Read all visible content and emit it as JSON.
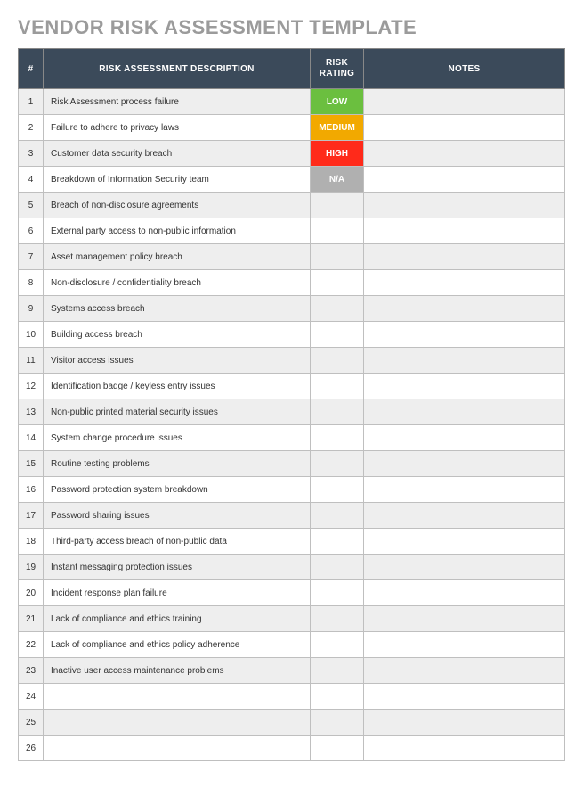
{
  "title": "VENDOR RISK ASSESSMENT TEMPLATE",
  "columns": {
    "num": "#",
    "desc": "RISK ASSESSMENT DESCRIPTION",
    "rating": "RISK RATING",
    "notes": "NOTES"
  },
  "ratingColors": {
    "LOW": "low",
    "MEDIUM": "medium",
    "HIGH": "high",
    "N/A": "na"
  },
  "rows": [
    {
      "num": "1",
      "desc": "Risk Assessment process failure",
      "rating": "LOW",
      "notes": ""
    },
    {
      "num": "2",
      "desc": "Failure to adhere to privacy laws",
      "rating": "MEDIUM",
      "notes": ""
    },
    {
      "num": "3",
      "desc": "Customer data security breach",
      "rating": "HIGH",
      "notes": ""
    },
    {
      "num": "4",
      "desc": "Breakdown of Information Security team",
      "rating": "N/A",
      "notes": ""
    },
    {
      "num": "5",
      "desc": "Breach of non-disclosure agreements",
      "rating": "",
      "notes": ""
    },
    {
      "num": "6",
      "desc": "External party access to non-public information",
      "rating": "",
      "notes": ""
    },
    {
      "num": "7",
      "desc": "Asset management policy breach",
      "rating": "",
      "notes": ""
    },
    {
      "num": "8",
      "desc": "Non-disclosure / confidentiality breach",
      "rating": "",
      "notes": ""
    },
    {
      "num": "9",
      "desc": "Systems access breach",
      "rating": "",
      "notes": ""
    },
    {
      "num": "10",
      "desc": "Building access breach",
      "rating": "",
      "notes": ""
    },
    {
      "num": "11",
      "desc": "Visitor access issues",
      "rating": "",
      "notes": ""
    },
    {
      "num": "12",
      "desc": "Identification badge / keyless entry issues",
      "rating": "",
      "notes": ""
    },
    {
      "num": "13",
      "desc": "Non-public printed material security issues",
      "rating": "",
      "notes": ""
    },
    {
      "num": "14",
      "desc": "System change procedure issues",
      "rating": "",
      "notes": ""
    },
    {
      "num": "15",
      "desc": "Routine testing problems",
      "rating": "",
      "notes": ""
    },
    {
      "num": "16",
      "desc": "Password protection system breakdown",
      "rating": "",
      "notes": ""
    },
    {
      "num": "17",
      "desc": "Password sharing issues",
      "rating": "",
      "notes": ""
    },
    {
      "num": "18",
      "desc": "Third-party access breach of non-public data",
      "rating": "",
      "notes": ""
    },
    {
      "num": "19",
      "desc": "Instant messaging protection issues",
      "rating": "",
      "notes": ""
    },
    {
      "num": "20",
      "desc": "Incident response plan failure",
      "rating": "",
      "notes": ""
    },
    {
      "num": "21",
      "desc": "Lack of compliance and ethics training",
      "rating": "",
      "notes": ""
    },
    {
      "num": "22",
      "desc": "Lack of compliance and ethics policy adherence",
      "rating": "",
      "notes": ""
    },
    {
      "num": "23",
      "desc": "Inactive user access maintenance problems",
      "rating": "",
      "notes": ""
    },
    {
      "num": "24",
      "desc": "",
      "rating": "",
      "notes": ""
    },
    {
      "num": "25",
      "desc": "",
      "rating": "",
      "notes": ""
    },
    {
      "num": "26",
      "desc": "",
      "rating": "",
      "notes": ""
    }
  ]
}
